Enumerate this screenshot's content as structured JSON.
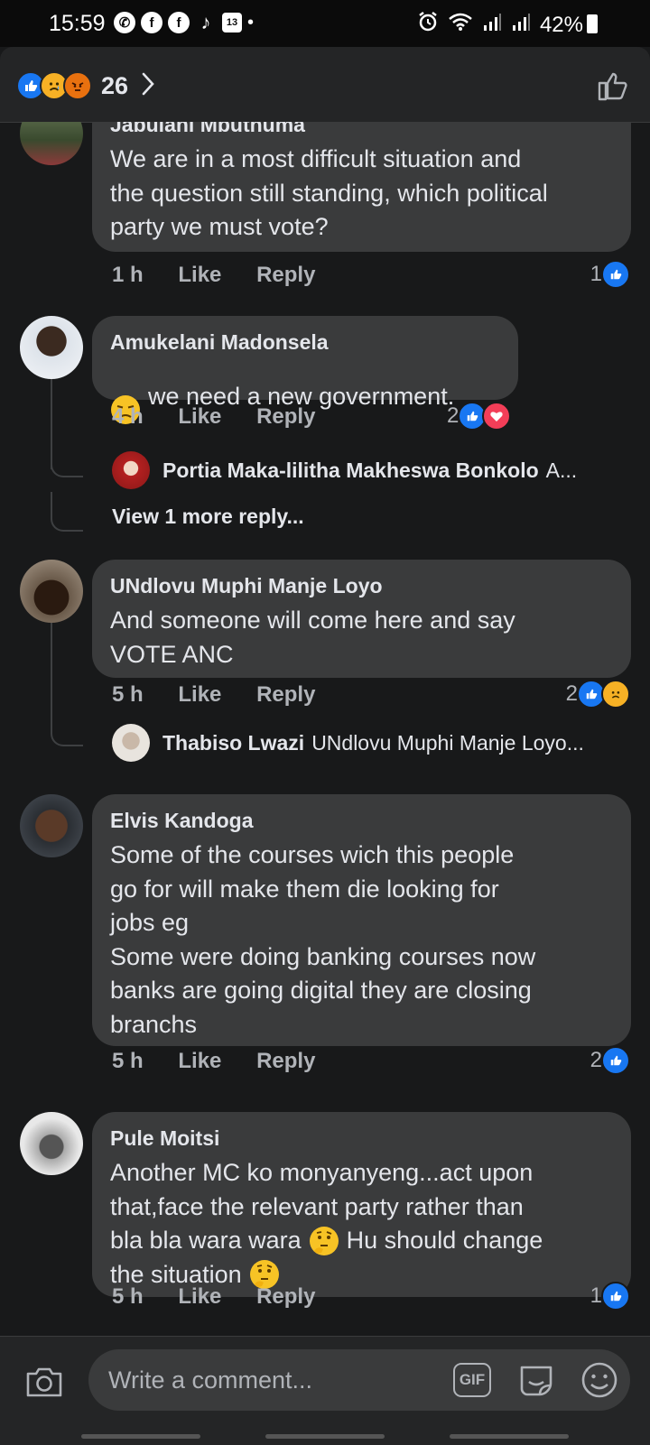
{
  "status_bar": {
    "time": "15:59",
    "battery": "42%",
    "calendar_day": "13"
  },
  "reactions_header": {
    "count": "26",
    "reactions": [
      "like-icon",
      "sad-icon",
      "angry-icon"
    ]
  },
  "comments": [
    {
      "author": "Jabulani Mbuthuma",
      "text": "We are in a most difficult situation and\nthe question still standing, which political\nparty we must vote?",
      "time": "1 h",
      "like_label": "Like",
      "reply_label": "Reply",
      "reaction_count": "1"
    },
    {
      "author": "Amukelani Madonsela",
      "text": "we need a new government.",
      "time": "4 h",
      "like_label": "Like",
      "reply_label": "Reply",
      "reaction_count": "2",
      "reply_preview": {
        "author": "Portia Maka-lilitha Makheswa Bonkolo",
        "text": "A..."
      },
      "view_more": "View 1 more reply..."
    },
    {
      "author": "UNdlovu Muphi Manje Loyo",
      "text": "And someone will come here and say\nVOTE ANC",
      "time": "5 h",
      "like_label": "Like",
      "reply_label": "Reply",
      "reaction_count": "2",
      "reply_preview": {
        "author": "Thabiso Lwazi",
        "text": "UNdlovu Muphi Manje Loyo..."
      }
    },
    {
      "author": "Elvis Kandoga",
      "text": "Some of the courses  wich this people\ngo for will make them die looking  for\njobs eg\nSome were doing banking  courses now\nbanks are going digital  they are closing\nbranchs",
      "time": "5 h",
      "like_label": "Like",
      "reply_label": "Reply",
      "reaction_count": "2"
    },
    {
      "author": "Pule Moitsi",
      "text_line1": "Another MC ko monyanyeng...act upon",
      "text_line2": "that,face the relevant party rather than",
      "text_line3_a": "bla bla wara wara",
      "text_line3_b": "Hu should change",
      "text_line4": "the situation",
      "time": "5 h",
      "like_label": "Like",
      "reply_label": "Reply",
      "reaction_count": "1"
    }
  ],
  "composer": {
    "placeholder": "Write a comment...",
    "gif_label": "GIF"
  },
  "colors": {
    "background": "#18191a",
    "bubble": "#3a3b3c",
    "like_blue": "#1877f2",
    "love_red": "#f33e58",
    "sad_yellow": "#f7b125"
  }
}
